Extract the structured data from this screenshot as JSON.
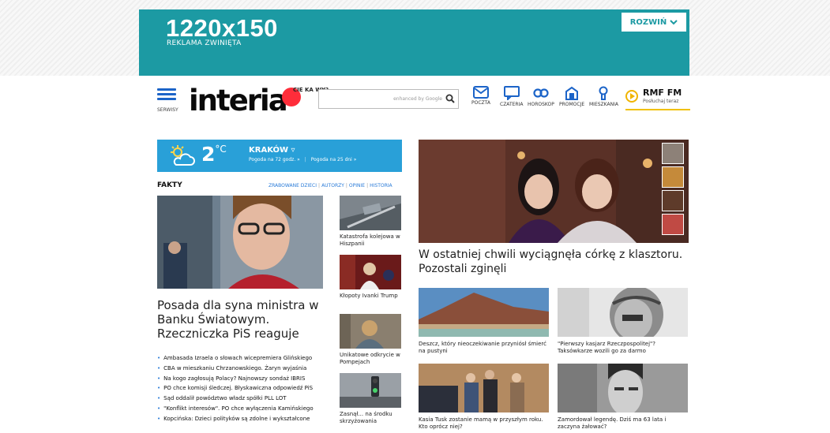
{
  "ad": {
    "size": "1220x150",
    "subtitle": "REKLAMA ZWINIĘTA",
    "expand_label": "ROZWIŃ"
  },
  "header": {
    "menu_label": "SERWISY",
    "logo": "interia",
    "logo_tag": "CIE KA WY?",
    "search_placeholder": "enhanced by Google",
    "nav": [
      {
        "label": "POCZTA",
        "icon": "mail-icon"
      },
      {
        "label": "CZATERIA",
        "icon": "chat-icon"
      },
      {
        "label": "HOROSKOP",
        "icon": "horoscope-icon"
      },
      {
        "label": "PROMOCJE",
        "icon": "promo-icon"
      },
      {
        "label": "MIESZKANIA",
        "icon": "keyhole-icon"
      }
    ],
    "radio_title": "RMF FM",
    "radio_sub": "Posłuchaj teraz"
  },
  "weather": {
    "temp": "2",
    "unit": "°C",
    "city": "KRAKÓW",
    "link1": "Pogoda na 72 godz. »",
    "link2": "Pogoda na 25 dni »"
  },
  "fakty": {
    "heading": "FAKTY",
    "nav": [
      "ZRABOWANE DZIECI",
      "AUTORZY",
      "OPINIE",
      "HISTORIA"
    ],
    "lead_title": "Posada dla syna ministra w Banku Światowym. Rzeczniczka PiS reaguje",
    "bullets": [
      "Ambasada Izraela o słowach wicepremiera Glińskiego",
      "CBA w mieszkaniu Chrzanowskiego. Żaryn wyjaśnia",
      "Na kogo zagłosują Polacy? Najnowszy sondaż IBRIS",
      "PO chce komisji śledczej. Błyskawiczna odpowiedź PiS",
      "Sąd oddalił powództwo władz spółki PLL LOT",
      "\"Konflikt interesów\". PO chce wyłączenia Kamińskiego",
      "Kopcińska: Dzieci polityków są zdolne i wykształcone"
    ],
    "side": [
      "Katastrofa kolejowa w Hiszpanii",
      "Kłopoty Ivanki Trump",
      "Unikatowe odkrycie w Pompejach",
      "Zasnął... na środku skrzyżowania"
    ]
  },
  "main": {
    "big_title": "W ostatniej chwili wyciągnęła córkę z klasztoru. Pozostali zginęli",
    "cards": [
      "Deszcz, który nieoczekiwanie przyniósł śmierć na pustyni",
      "\"Pierwszy kasjarz Rzeczpospolitej\"? Taksówkarze wozili go za darmo",
      "Kasia Tusk zostanie mamą w przyszłym roku. Kto oprócz niej?",
      "Zamordował legendę. Dziś ma 63 lata i zaczyna żałować?"
    ]
  }
}
